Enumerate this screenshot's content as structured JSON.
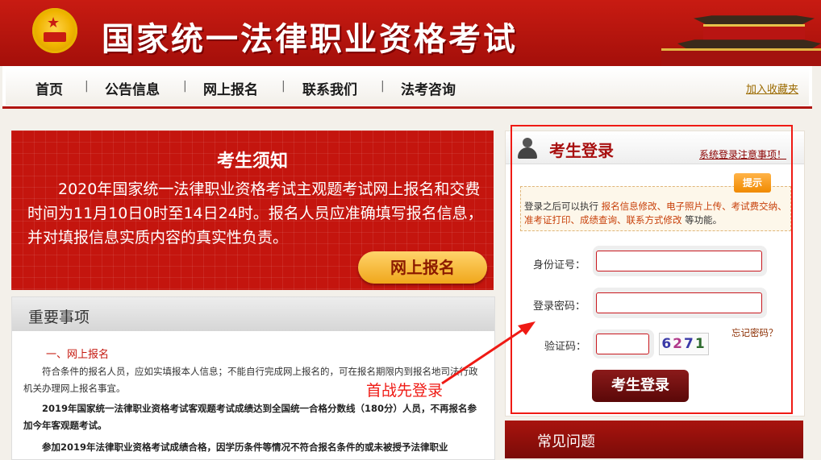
{
  "header": {
    "site_title": "国家统一法律职业资格考试"
  },
  "nav": {
    "items": [
      "首页",
      "公告信息",
      "网上报名",
      "联系我们",
      "法考咨询"
    ],
    "separator": "|",
    "favorite": "加入收藏夹"
  },
  "notice": {
    "title": "考生须知",
    "body": "2020年国家统一法律职业资格考试主观题考试网上报名和交费时间为11月10日0时至14日24时。报名人员应准确填写报名信息，并对填报信息实质内容的真实性负责。",
    "button": "网上报名"
  },
  "important": {
    "title": "重要事项",
    "subtitle": "一、网上报名",
    "p1": "符合条件的报名人员，应如实填报本人信息；不能自行完成网上报名的，可在报名期限内到报名地司法行政机关办理网上报名事宜。",
    "p2": "2019年国家统一法律职业资格考试客观题考试成绩达到全国统一合格分数线（180分）人员，不再报名参加今年客观题考试。",
    "p3": "参加2019年法律职业资格考试成绩合格，因学历条件等情况不符合报名条件的或未被授予法律职业"
  },
  "login": {
    "title": "考生登录",
    "note": "系统登录注意事项！",
    "tips_badge": "提示",
    "tips_prefix": "登录之后可以执行",
    "tips_links": "报名信息修改、电子照片上传、考试费交纳、准考证打印、成绩查询、联系方式修改",
    "tips_suffix": "等功能。",
    "id_label": "身份证号：",
    "password_label": "登录密码：",
    "captcha_label": "验证码：",
    "captcha_value": "6271",
    "forgot": "忘记密码？",
    "button": "考生登录"
  },
  "faq": {
    "title": "常见问题"
  },
  "annotation": {
    "text": "首战先登录",
    "color": "#ef1a14"
  }
}
